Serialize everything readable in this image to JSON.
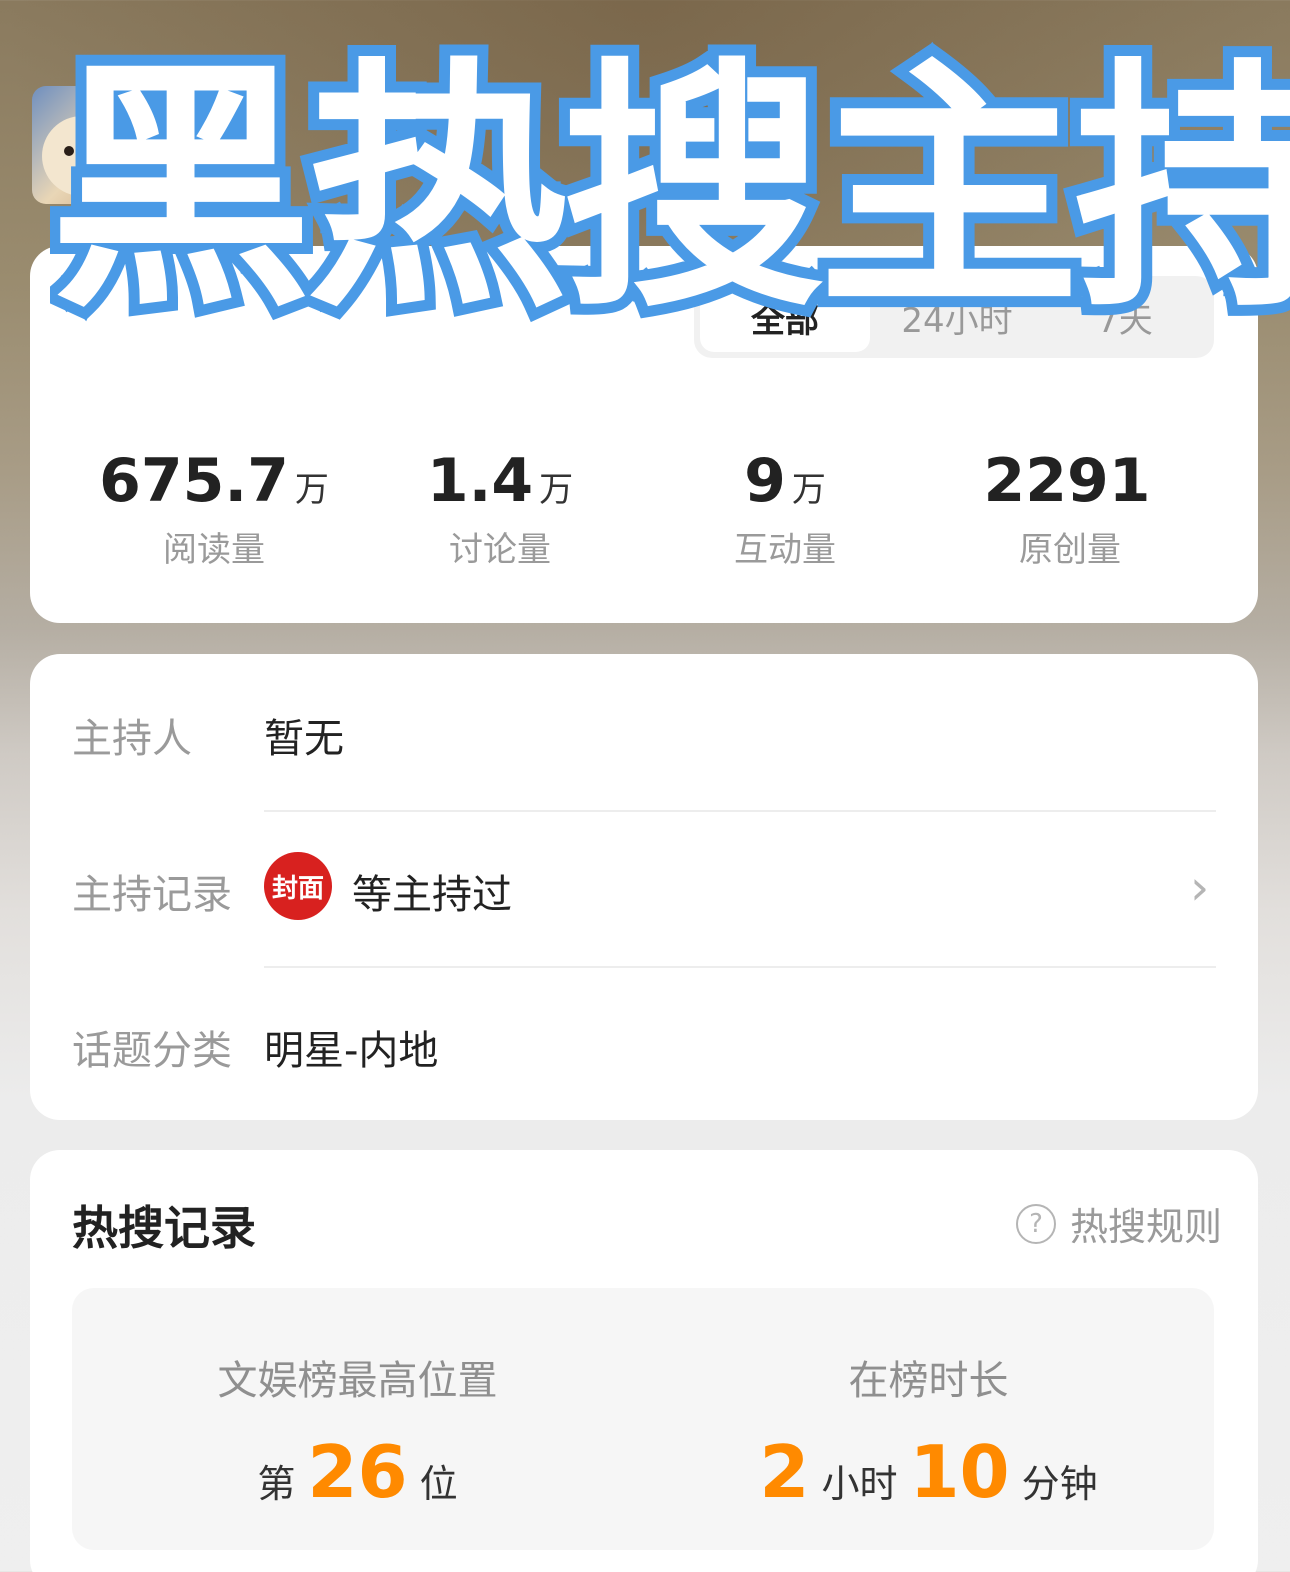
{
  "header": {
    "overlay_text": "黑热搜主持"
  },
  "overview": {
    "segments": [
      "全部",
      "24小时",
      "7天"
    ],
    "stats": [
      {
        "value": "675.7",
        "unit": "万",
        "label": "阅读量"
      },
      {
        "value": "1.4",
        "unit": "万",
        "label": "讨论量"
      },
      {
        "value": "9",
        "unit": "万",
        "label": "互动量"
      },
      {
        "value": "2291",
        "unit": "",
        "label": "原创量"
      }
    ]
  },
  "host": {
    "host_label": "主持人",
    "host_value": "暂无",
    "record_label": "主持记录",
    "record_logo": "封面",
    "record_value": "等主持过",
    "category_label": "话题分类",
    "category_value": "明星-内地"
  },
  "record": {
    "title": "热搜记录",
    "rules_label": "热搜规则",
    "highest_label": "文娱榜最高位置",
    "highest_prefix": "第",
    "highest_value": "26",
    "highest_suffix": "位",
    "duration_label": "在榜时长",
    "duration_hours": "2",
    "duration_hours_unit": "小时",
    "duration_minutes": "10",
    "duration_minutes_unit": "分钟"
  },
  "colors": {
    "accent_orange": "#ff8a00",
    "overlay_blue": "#4a9ae6",
    "logo_red": "#d8211f"
  }
}
